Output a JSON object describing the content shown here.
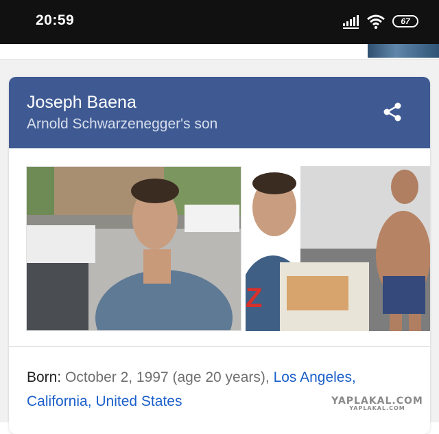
{
  "status_bar": {
    "time": "20:59",
    "battery_level": "67",
    "icons": [
      "signal-icon",
      "wifi-icon",
      "battery-icon"
    ]
  },
  "knowledge_card": {
    "title": "Joseph Baena",
    "subtitle": "Arnold Schwarzenegger's son",
    "header_color": "#3f5a93",
    "share_icon": "share-icon",
    "photos": [
      {
        "name": "photo-person-parking-lot"
      },
      {
        "name": "photo-person-beach"
      }
    ],
    "born": {
      "label": "Born:",
      "value": "October 2, 1997 (age 20 years),",
      "place_city": "Los Angeles,",
      "place_state": "California,",
      "place_country": "United States"
    }
  },
  "watermark": {
    "main": "YAPLAKAL.COM",
    "sub": "YAPLAKAL.COM"
  },
  "colors": {
    "link": "#1a5fc9",
    "header": "#3f5a93",
    "status_bar": "#111111"
  }
}
